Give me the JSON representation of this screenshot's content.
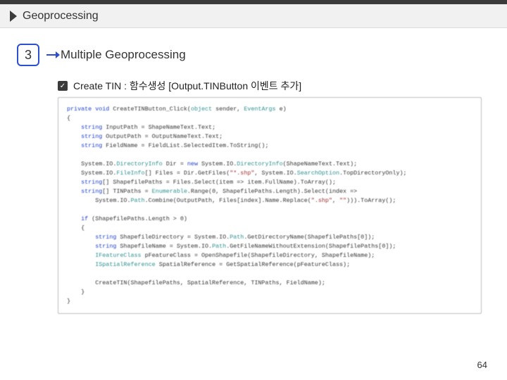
{
  "header": {
    "title": "Geoprocessing"
  },
  "section": {
    "number": "3",
    "title": "Multiple Geoprocessing"
  },
  "subtitle": "Create TIN : 함수생성 [Output.TINButton 이벤트 추가]",
  "code": {
    "lines": [
      [
        "<kw>private void</kw> CreateTINButton_Click(<typ>object</typ> sender, <typ>EventArgs</typ> e)"
      ],
      [
        "{"
      ],
      [
        "    <kw>string</kw> InputPath = ShapeNameText.Text;"
      ],
      [
        "    <kw>string</kw> OutputPath = OutputNameText.Text;"
      ],
      [
        "    <kw>string</kw> FieldName = FieldList.SelectedItem.ToString();"
      ],
      [
        ""
      ],
      [
        "    System.IO.<typ>DirectoryInfo</typ> Dir = <kw>new</kw> System.IO.<typ>DirectoryInfo</typ>(ShapeNameText.Text);"
      ],
      [
        "    System.IO.<typ>FileInfo</typ>[] Files = Dir.GetFiles(<str>\"*.shp\"</str>, System.IO.<typ>SearchOption</typ>.TopDirectoryOnly);"
      ],
      [
        "    <kw>string</kw>[] ShapefilePaths = Files.Select(item => item.FullName).ToArray();"
      ],
      [
        "    <kw>string</kw>[] TINPaths = <typ>Enumerable</typ>.Range(0, ShapefilePaths.Length).Select(index =>"
      ],
      [
        "        System.IO.<typ>Path</typ>.Combine(OutputPath, Files[index].Name.Replace(<str>\".shp\"</str>, <str>\"\"</str>))).ToArray();"
      ],
      [
        ""
      ],
      [
        "    <kw>if</kw> (ShapefilePaths.Length > 0)"
      ],
      [
        "    {"
      ],
      [
        "        <kw>string</kw> ShapefileDirectory = System.IO.<typ>Path</typ>.GetDirectoryName(ShapefilePaths[0]);"
      ],
      [
        "        <kw>string</kw> ShapefileName = System.IO.<typ>Path</typ>.GetFileNameWithoutExtension(ShapefilePaths[0]);"
      ],
      [
        "        <typ>IFeatureClass</typ> pFeatureClass = OpenShapefile(ShapefileDirectory, ShapefileName);"
      ],
      [
        "        <typ>ISpatialReference</typ> SpatialReference = GetSpatialReference(pFeatureClass);"
      ],
      [
        ""
      ],
      [
        "        CreateTIN(ShapefilePaths, SpatialReference, TINPaths, FieldName);"
      ],
      [
        "    }"
      ],
      [
        "}"
      ]
    ]
  },
  "page_number": "64"
}
